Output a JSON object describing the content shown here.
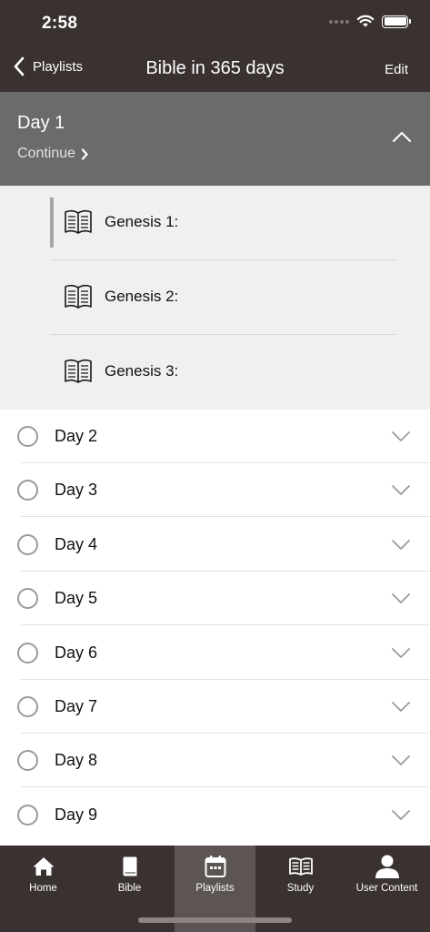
{
  "status": {
    "time": "2:58"
  },
  "nav": {
    "back_label": "Playlists",
    "title": "Bible in 365 days",
    "edit_label": "Edit"
  },
  "expanded_day": {
    "title": "Day 1",
    "continue_label": "Continue",
    "readings": [
      {
        "label": "Genesis 1:"
      },
      {
        "label": "Genesis 2:"
      },
      {
        "label": "Genesis 3:"
      }
    ]
  },
  "days": [
    {
      "label": "Day 2"
    },
    {
      "label": "Day 3"
    },
    {
      "label": "Day 4"
    },
    {
      "label": "Day 5"
    },
    {
      "label": "Day 6"
    },
    {
      "label": "Day 7"
    },
    {
      "label": "Day 8"
    },
    {
      "label": "Day 9"
    }
  ],
  "tabs": [
    {
      "label": "Home",
      "icon": "home-icon",
      "active": false
    },
    {
      "label": "Bible",
      "icon": "bible-icon",
      "active": false
    },
    {
      "label": "Playlists",
      "icon": "calendar-icon",
      "active": true
    },
    {
      "label": "Study",
      "icon": "open-book-icon",
      "active": false
    },
    {
      "label": "User Content",
      "icon": "user-icon",
      "active": false
    }
  ],
  "colors": {
    "header_bg": "#3a3230",
    "expanded_header_bg": "#6b6b6b",
    "expanded_body_bg": "#f0f0f0",
    "active_tab_bg": "#5c5553"
  }
}
